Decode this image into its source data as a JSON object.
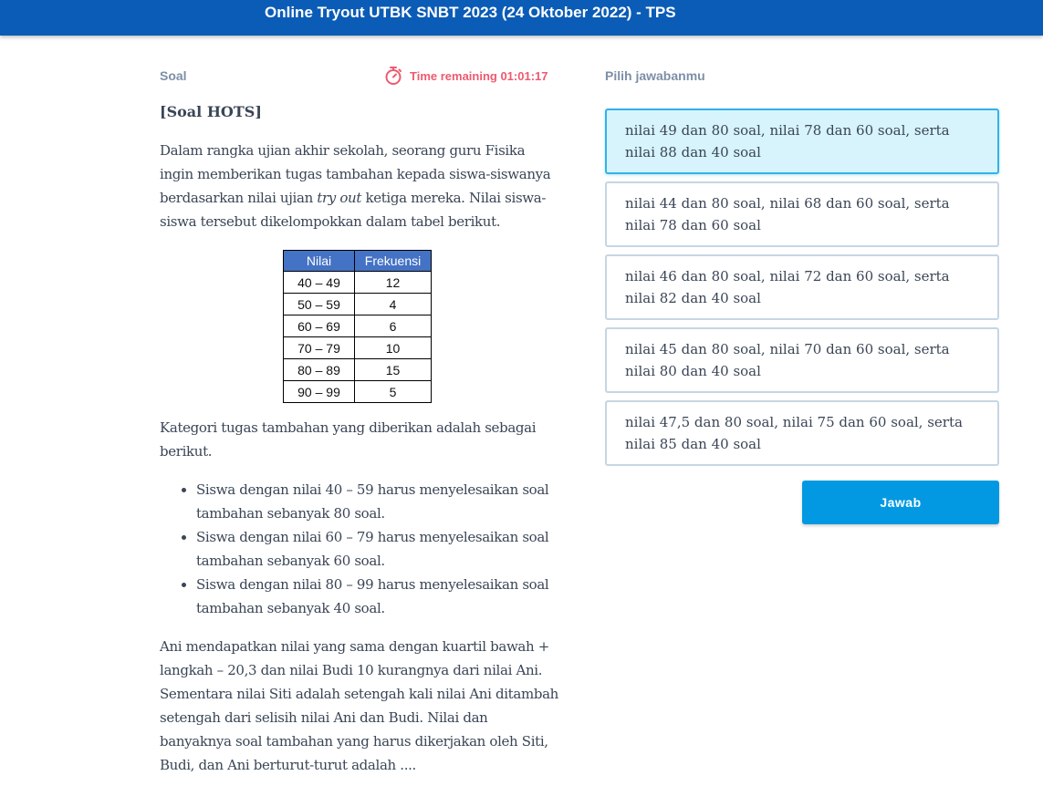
{
  "header": {
    "title": "Online Tryout UTBK SNBT 2023 (24 Oktober 2022) - TPS"
  },
  "question": {
    "section_label": "Soal",
    "timer": {
      "icon": "stopwatch-icon",
      "text": "Time remaining 01:01:17",
      "color": "#ee5a6f"
    },
    "heading": "[Soal HOTS]",
    "intro_before": "Dalam rangka ujian akhir sekolah, seorang guru Fisika ingin memberikan tugas tambahan kepada siswa-siswanya berdasarkan nilai ujian ",
    "intro_em": "try out",
    "intro_after": " ketiga mereka. Nilai siswa-siswa tersebut dikelompokkan dalam tabel berikut.",
    "table": {
      "headers": [
        "Nilai",
        "Frekuensi"
      ],
      "rows": [
        [
          "40 – 49",
          "12"
        ],
        [
          "50 – 59",
          "4"
        ],
        [
          "60 – 69",
          "6"
        ],
        [
          "70 – 79",
          "10"
        ],
        [
          "80 – 89",
          "15"
        ],
        [
          "90 – 99",
          "5"
        ]
      ]
    },
    "category_text": "Kategori tugas tambahan yang diberikan adalah sebagai berikut.",
    "bullets": [
      "Siswa dengan nilai 40 – 59 harus menyelesaikan soal tambahan sebanyak 80 soal.",
      "Siswa dengan nilai 60 – 79 harus menyelesaikan soal tambahan sebanyak 60 soal.",
      "Siswa dengan nilai 80 – 99 harus menyelesaikan soal tambahan sebanyak 40 soal."
    ],
    "closing_text": "Ani mendapatkan nilai yang sama dengan kuartil bawah + langkah – 20,3 dan nilai Budi 10 kurangnya dari nilai Ani. Sementara nilai Siti adalah setengah kali nilai Ani ditambah setengah dari selisih nilai Ani dan Budi. Nilai dan banyaknya soal tambahan yang harus dikerjakan oleh Siti, Budi, dan Ani berturut-turut adalah ...."
  },
  "answers": {
    "label": "Pilih jawabanmu",
    "selected_index": 0,
    "options": [
      "nilai 49 dan 80 soal, nilai 78 dan 60 soal, serta nilai 88 dan 40 soal",
      "nilai 44 dan 80 soal, nilai 68 dan 60 soal, serta nilai 78 dan 60 soal",
      "nilai 46 dan 80 soal, nilai 72 dan 60 soal, serta nilai 82 dan 40 soal",
      "nilai 45 dan 80 soal, nilai 70 dan 60 soal, serta nilai 80 dan 40 soal",
      "nilai 47,5 dan 80 soal, nilai 75 dan 60 soal, serta nilai 85 dan 40 soal"
    ],
    "submit_label": "Jawab"
  },
  "colors": {
    "header_bg": "#0b5cb6",
    "selected_bg": "#d7f3fc",
    "selected_border": "#33b3e6",
    "button_bg": "#0399e2",
    "table_header_bg": "#4472c4"
  }
}
